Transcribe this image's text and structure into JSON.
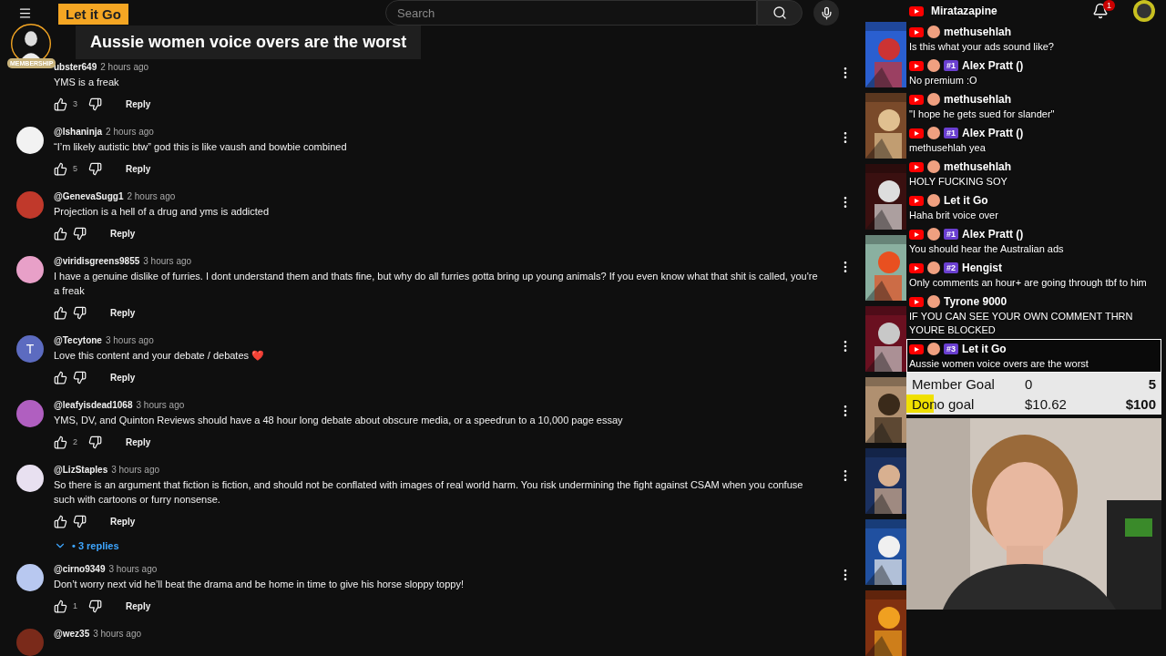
{
  "topbar": {
    "search": {
      "placeholder": "Search"
    },
    "notifications": "1"
  },
  "alert": {
    "name": "Let it Go",
    "badge": "MEMBERSHIP",
    "message": "Aussie women voice overs are the worst"
  },
  "comments": [
    {
      "author": "ubster649",
      "time": "2 hours ago",
      "text": "YMS is a freak",
      "likes": "3",
      "reply": "Reply"
    },
    {
      "author": "@Ishaninja",
      "time": "2 hours ago",
      "text": "“I’m likely autistic btw” god this is like vaush and bowbie combined",
      "likes": "5",
      "reply": "Reply",
      "color": "#f2f2f2"
    },
    {
      "author": "@GenevaSugg1",
      "time": "2 hours ago",
      "text": "Projection is a hell of a drug and yms is addicted",
      "reply": "Reply",
      "color": "#c0392b"
    },
    {
      "author": "@viridisgreens9855",
      "time": "3 hours ago",
      "text": "I have a genuine dislike of furries. I dont understand them and thats fine, but why do all furries gotta bring up young animals? If you even know what that shit is called, you're a freak",
      "reply": "Reply",
      "color": "#e8a0c8"
    },
    {
      "author": "@Tecytone",
      "time": "3 hours ago",
      "text": "Love this content and your debate / debates ❤️",
      "reply": "Reply",
      "color": "#5c6bc0",
      "letter": "T"
    },
    {
      "author": "@leafyisdead1068",
      "time": "3 hours ago",
      "text": "YMS, DV, and Quinton Reviews should have a 48 hour long debate about obscure media, or a speedrun to a 10,000 page essay",
      "likes": "2",
      "reply": "Reply",
      "color": "#b05fc0"
    },
    {
      "author": "@LizStaples",
      "time": "3 hours ago",
      "text": "So there is an argument that fiction is fiction, and should not be conflated with images of real world harm. You risk undermining the fight against CSAM when you confuse such with cartoons or furry nonsense.",
      "reply": "Reply",
      "color": "#e8e0f0",
      "replies": "• 3 replies"
    },
    {
      "author": "@cirno9349",
      "time": "3 hours ago",
      "text": "Don’t worry next vid he’ll beat the drama and be home in time to give his horse sloppy toppy!",
      "likes": "1",
      "reply": "Reply",
      "color": "#b8c8f0"
    },
    {
      "author": "@wez35",
      "time": "3 hours ago",
      "color": "#7a2a1a"
    }
  ],
  "chat": {
    "top_name": "Miratazapine",
    "messages": [
      {
        "name": "methusehlah",
        "text": "Is this what your ads sound like?"
      },
      {
        "name": "Alex Pratt ()",
        "rank": "#1",
        "text": "No premium :O"
      },
      {
        "name": "methusehlah",
        "text": "\"I hope he gets sued for slander\""
      },
      {
        "name": "Alex Pratt ()",
        "rank": "#1",
        "text": "methusehlah yea"
      },
      {
        "name": "methusehlah",
        "text": "HOLY FUCKING SOY"
      },
      {
        "name": "Let it Go",
        "text": "Haha brit voice over"
      },
      {
        "name": "Alex Pratt ()",
        "rank": "#1",
        "text": "You should hear the Australian ads"
      },
      {
        "name": "Hengist",
        "rank": "#2",
        "text": "Only comments an hour+ are going through tbf to him"
      },
      {
        "name": "Tyrone 9000",
        "text": "IF YOU CAN SEE YOUR OWN COMMENT THRN YOURE BLOCKED"
      },
      {
        "name": "Let it Go",
        "rank": "#3",
        "text": "Aussie women voice overs are the worst",
        "highlighted": true
      }
    ]
  },
  "goals": [
    {
      "label": "Member Goal",
      "current": "0",
      "target": "5"
    },
    {
      "label": "Dono goal",
      "current": "$10.62",
      "target": "$100",
      "level": 0.1062
    }
  ]
}
